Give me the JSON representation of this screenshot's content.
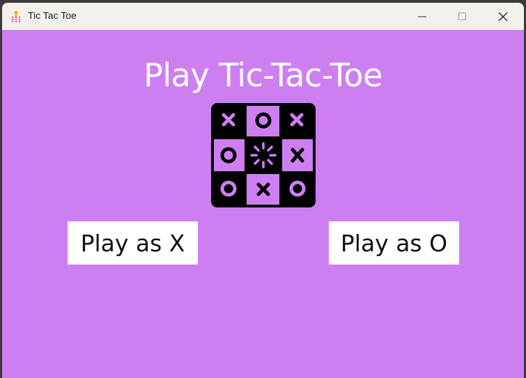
{
  "window": {
    "title": "Tic Tac Toe",
    "controls": {
      "minimize_icon": "minimize-icon",
      "maximize_icon": "maximize-icon",
      "close_icon": "close-icon"
    }
  },
  "main": {
    "heading": "Play Tic-Tac-Toe",
    "logo_icon": "tic-tac-toe-board-icon",
    "buttons": {
      "play_x": "Play as X",
      "play_o": "Play as O"
    }
  },
  "colors": {
    "background": "#cd7ff2",
    "titlebar": "#f4f1ec",
    "board": "#000000",
    "accent": "#cd7ff2",
    "button_bg": "#ffffff"
  }
}
